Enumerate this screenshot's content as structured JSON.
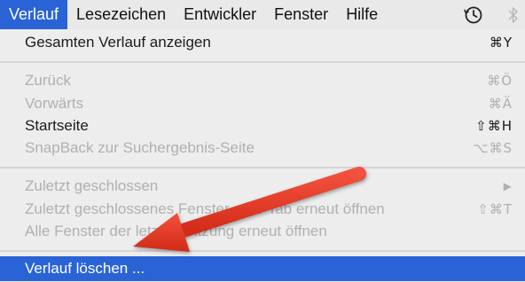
{
  "menubar": {
    "items": [
      {
        "label": "Verlauf",
        "active": true
      },
      {
        "label": "Lesezeichen"
      },
      {
        "label": "Entwickler"
      },
      {
        "label": "Fenster"
      },
      {
        "label": "Hilfe"
      }
    ],
    "icons": [
      "time-machine-icon",
      "bluetooth-icon"
    ]
  },
  "menu": {
    "items": [
      {
        "label": "Gesamten Verlauf anzeigen",
        "shortcut": "⌘Y",
        "state": "enabled"
      },
      {
        "label": "Zurück",
        "shortcut": "⌘Ö",
        "state": "disabled"
      },
      {
        "label": "Vorwärts",
        "shortcut": "⌘Ä",
        "state": "disabled"
      },
      {
        "label": "Startseite",
        "shortcut": "⇧⌘H",
        "state": "enabled"
      },
      {
        "label": "SnapBack zur Suchergebnis-Seite",
        "shortcut": "⌥⌘S",
        "state": "disabled"
      },
      {
        "label": "Zuletzt geschlossen",
        "shortcut": "▶",
        "state": "disabled"
      },
      {
        "label": "Zuletzt geschlossenes Fenster oder Tab erneut öffnen",
        "shortcut": "⇧⌘T",
        "state": "disabled"
      },
      {
        "label": "Alle Fenster der letzten Sitzung erneut öffnen",
        "shortcut": "",
        "state": "disabled"
      },
      {
        "label": "Verlauf löschen ...",
        "shortcut": "",
        "state": "highlighted"
      }
    ]
  },
  "colors": {
    "highlight": "#2a63d6",
    "arrow": "#e8321e"
  }
}
